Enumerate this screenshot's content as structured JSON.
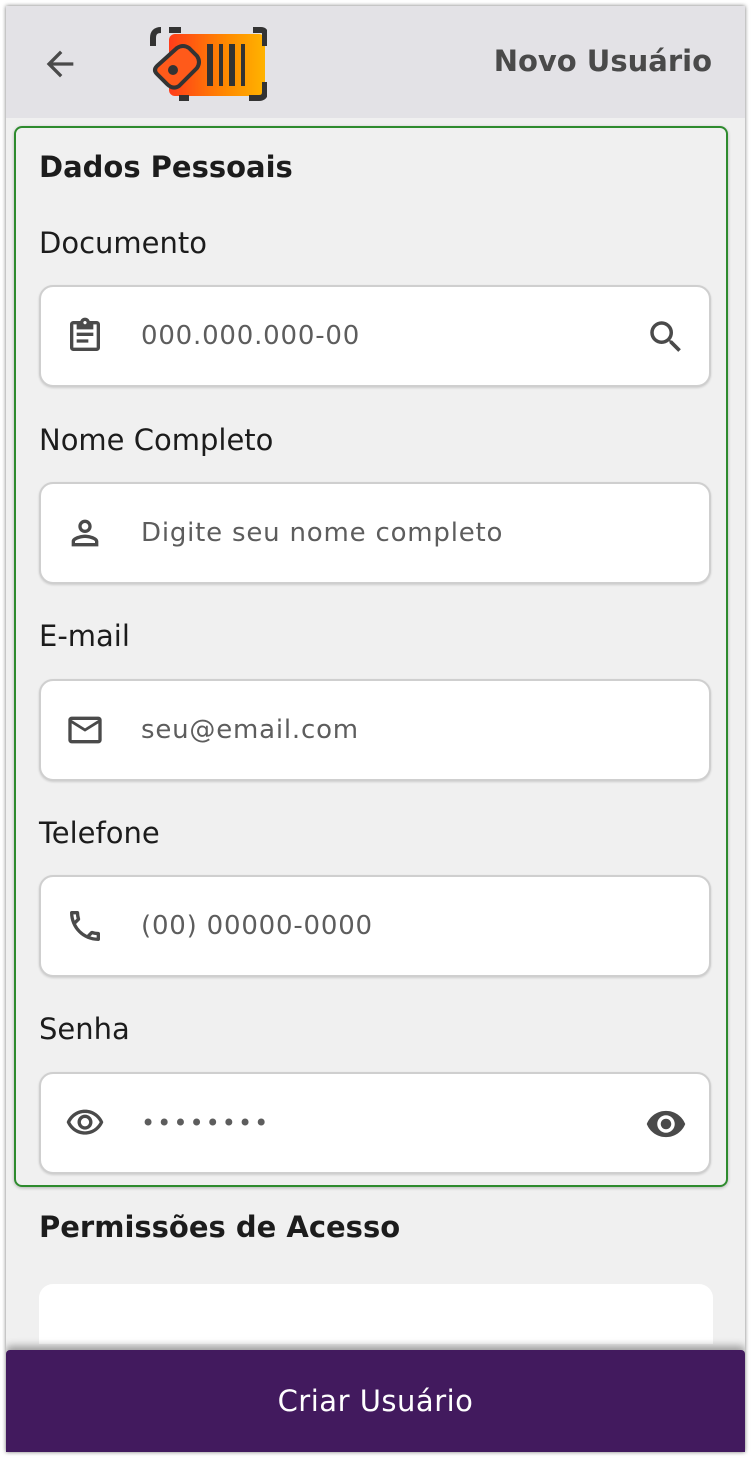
{
  "header": {
    "title": "Novo Usuário",
    "back_icon": "arrow-left-icon",
    "logo": "barcode-tag-logo"
  },
  "personal": {
    "section_title": "Dados Pessoais",
    "document": {
      "label": "Documento",
      "placeholder": "000.000.000-00",
      "icon": "clipboard-icon",
      "action_icon": "search-icon"
    },
    "name": {
      "label": "Nome Completo",
      "placeholder": "Digite seu nome completo",
      "icon": "person-icon"
    },
    "email": {
      "label": "E-mail",
      "placeholder": "seu@email.com",
      "icon": "mail-icon"
    },
    "phone": {
      "label": "Telefone",
      "placeholder": "(00) 00000-0000",
      "icon": "phone-icon"
    },
    "password": {
      "label": "Senha",
      "value": "••••••••",
      "icon": "eye-outline-icon",
      "action_icon": "eye-icon"
    }
  },
  "permissions": {
    "section_title": "Permissões de Acesso"
  },
  "footer": {
    "create_label": "Criar Usuário"
  },
  "colors": {
    "accent": "#421a5e",
    "section_border": "#2e8b2e",
    "logo_orange": "#ff7a00"
  }
}
